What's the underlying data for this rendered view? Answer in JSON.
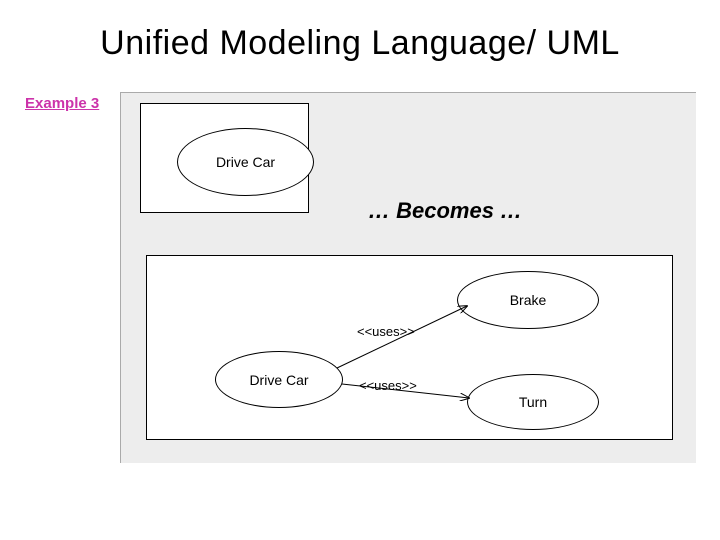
{
  "title": "Unified Modeling Language/ UML",
  "example_label": "Example 3",
  "top": {
    "drive_car": "Drive Car"
  },
  "becomes": "… Becomes …",
  "bottom": {
    "drive_car": "Drive Car",
    "brake": "Brake",
    "turn": "Turn",
    "uses1": "<<uses>>",
    "uses2": "<<uses>>"
  }
}
